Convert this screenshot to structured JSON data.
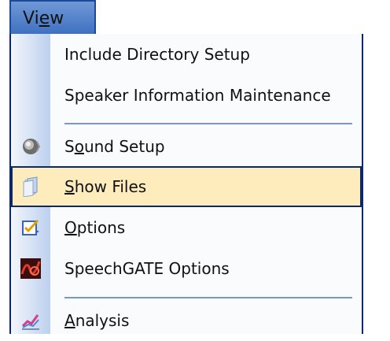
{
  "menubar": {
    "view_label_pre": "Vi",
    "view_mnemonic": "e",
    "view_label_post": "w"
  },
  "menu": {
    "items": [
      {
        "pre": "",
        "mnemonic": "",
        "post": "Include Directory Setup"
      },
      {
        "pre": "",
        "mnemonic": "",
        "post": "Speaker Information Maintenance"
      },
      {
        "pre": "S",
        "mnemonic": "o",
        "post": "und Setup",
        "icon": "speaker-icon"
      },
      {
        "pre": "",
        "mnemonic": "S",
        "post": "how Files",
        "icon": "files-icon"
      },
      {
        "pre": "",
        "mnemonic": "O",
        "post": "ptions",
        "icon": "options-checklist-icon"
      },
      {
        "pre": "",
        "mnemonic": "",
        "post": "SpeechGATE Options",
        "icon": "speechgate-icon"
      },
      {
        "pre": "",
        "mnemonic": "A",
        "post": "nalysis",
        "icon": "analysis-chart-icon"
      }
    ],
    "highlight_color": "#ffecbd",
    "border_color": "#0e2a66",
    "strip_color": "#bcd0ee"
  }
}
